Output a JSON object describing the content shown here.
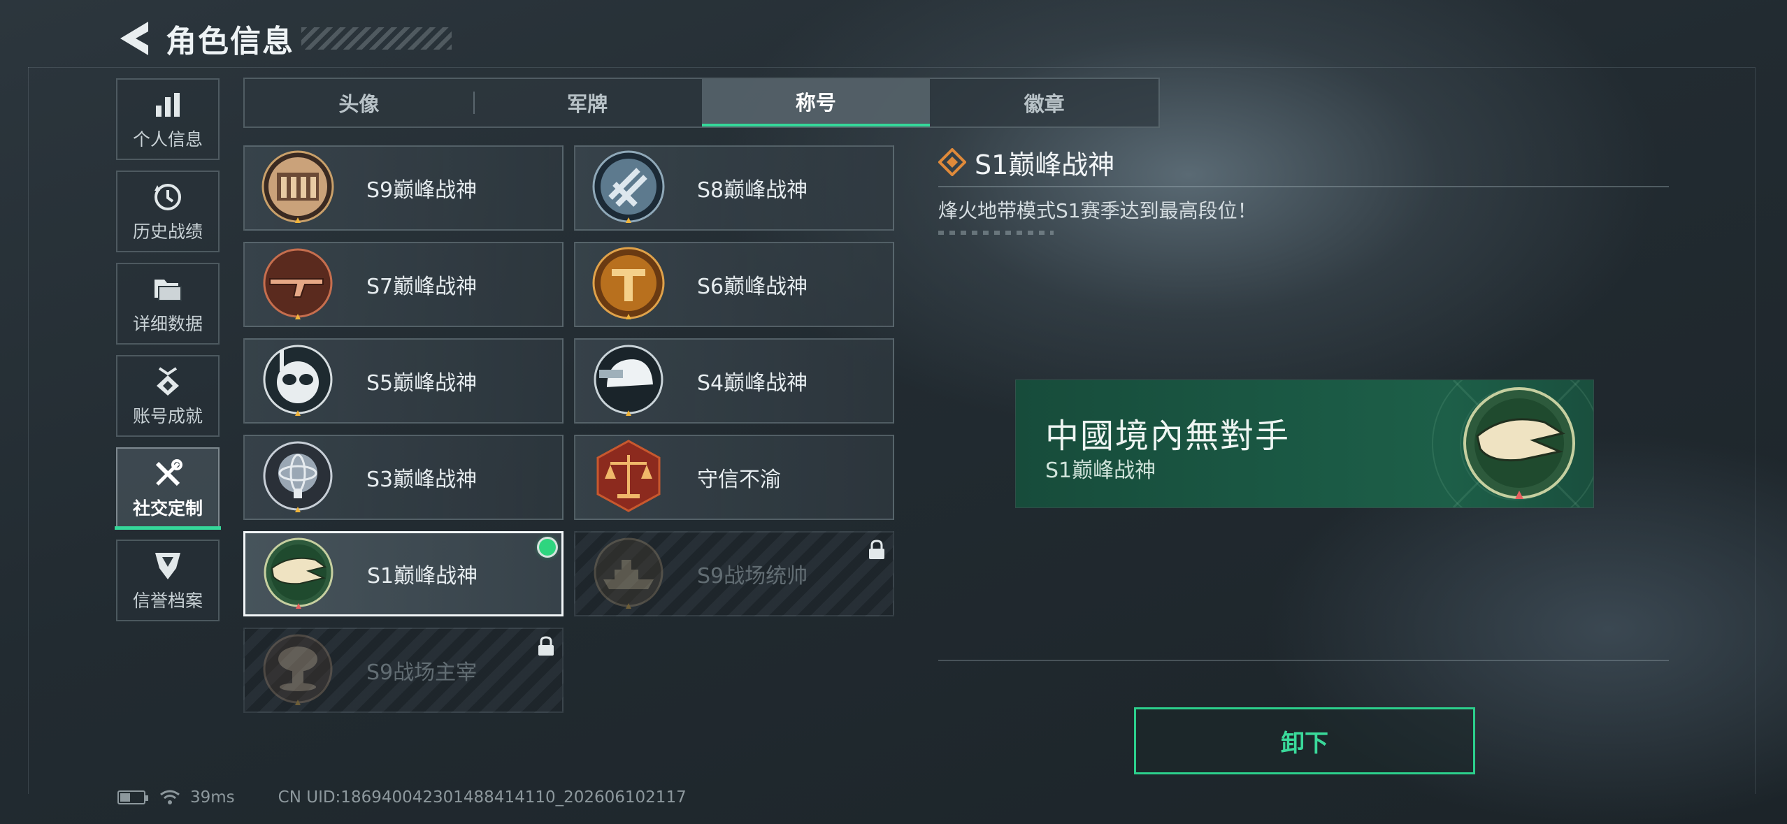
{
  "header": {
    "title": "角色信息"
  },
  "side_nav": [
    {
      "label": "个人信息",
      "icon": "bar-chart-icon",
      "active": false
    },
    {
      "label": "历史战绩",
      "icon": "history-clock-icon",
      "active": false
    },
    {
      "label": "详细数据",
      "icon": "folder-icon",
      "active": false
    },
    {
      "label": "账号成就",
      "icon": "achievement-medal-icon",
      "active": false
    },
    {
      "label": "社交定制",
      "icon": "tools-icon",
      "active": true
    },
    {
      "label": "信誉档案",
      "icon": "shield-emblem-icon",
      "active": false
    }
  ],
  "tabs": [
    {
      "label": "头像",
      "active": false
    },
    {
      "label": "军牌",
      "active": false
    },
    {
      "label": "称号",
      "active": true
    },
    {
      "label": "徽章",
      "active": false
    }
  ],
  "titles": [
    {
      "label": "S9巅峰战神",
      "emblem": "s9-fortress-emblem",
      "state": "normal"
    },
    {
      "label": "S8巅峰战神",
      "emblem": "s8-crossed-blades-emblem",
      "state": "normal"
    },
    {
      "label": "S7巅峰战神",
      "emblem": "s7-rifle-emblem",
      "state": "normal"
    },
    {
      "label": "S6巅峰战神",
      "emblem": "s6-t-shield-emblem",
      "state": "normal"
    },
    {
      "label": "S5巅峰战神",
      "emblem": "s5-diver-mask-emblem",
      "state": "normal"
    },
    {
      "label": "S4巅峰战神",
      "emblem": "s4-helmet-emblem",
      "state": "normal"
    },
    {
      "label": "S3巅峰战神",
      "emblem": "s3-atom-emblem",
      "state": "normal"
    },
    {
      "label": "守信不渝",
      "emblem": "justice-scales-emblem",
      "state": "normal"
    },
    {
      "label": "S1巅峰战神",
      "emblem": "s1-crocodile-emblem",
      "state": "selected"
    },
    {
      "label": "S9战场统帅",
      "emblem": "battleship-emblem",
      "state": "locked"
    },
    {
      "label": "S9战场主宰",
      "emblem": "mushroom-cloud-emblem",
      "state": "locked"
    }
  ],
  "detail": {
    "name": "S1巅峰战神",
    "description": "烽火地带模式S1赛季达到最高段位！",
    "banner_main": "中國境內無對手",
    "banner_sub": "S1巅峰战神",
    "action_label": "卸下"
  },
  "status": {
    "ping": "39ms",
    "uid": "CN UID:18694004230148841411​0_202606102117"
  },
  "colors": {
    "accent": "#35d89a",
    "banner": "#1b5a45"
  }
}
